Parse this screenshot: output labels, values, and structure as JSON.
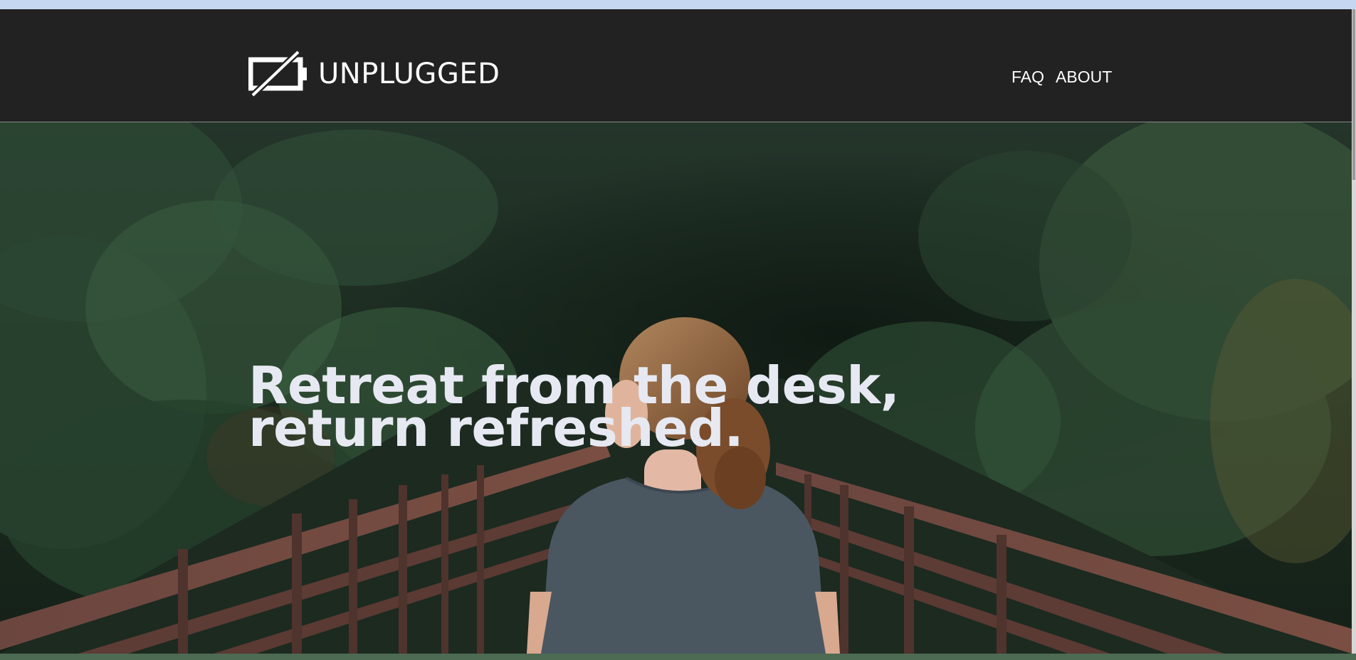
{
  "brand": {
    "name": "UNPLUGGED",
    "logo_icon": "unplugged-battery-icon"
  },
  "nav": {
    "items": [
      {
        "label": "FAQ"
      },
      {
        "label": "ABOUT"
      }
    ]
  },
  "hero": {
    "title": "Retreat from the desk, return refreshed.",
    "image": "woman-on-forest-bridge-photo"
  },
  "colors": {
    "header_bg": "#222222",
    "title_text": "#e7e9f2",
    "top_strip": "#c6d8f1"
  }
}
